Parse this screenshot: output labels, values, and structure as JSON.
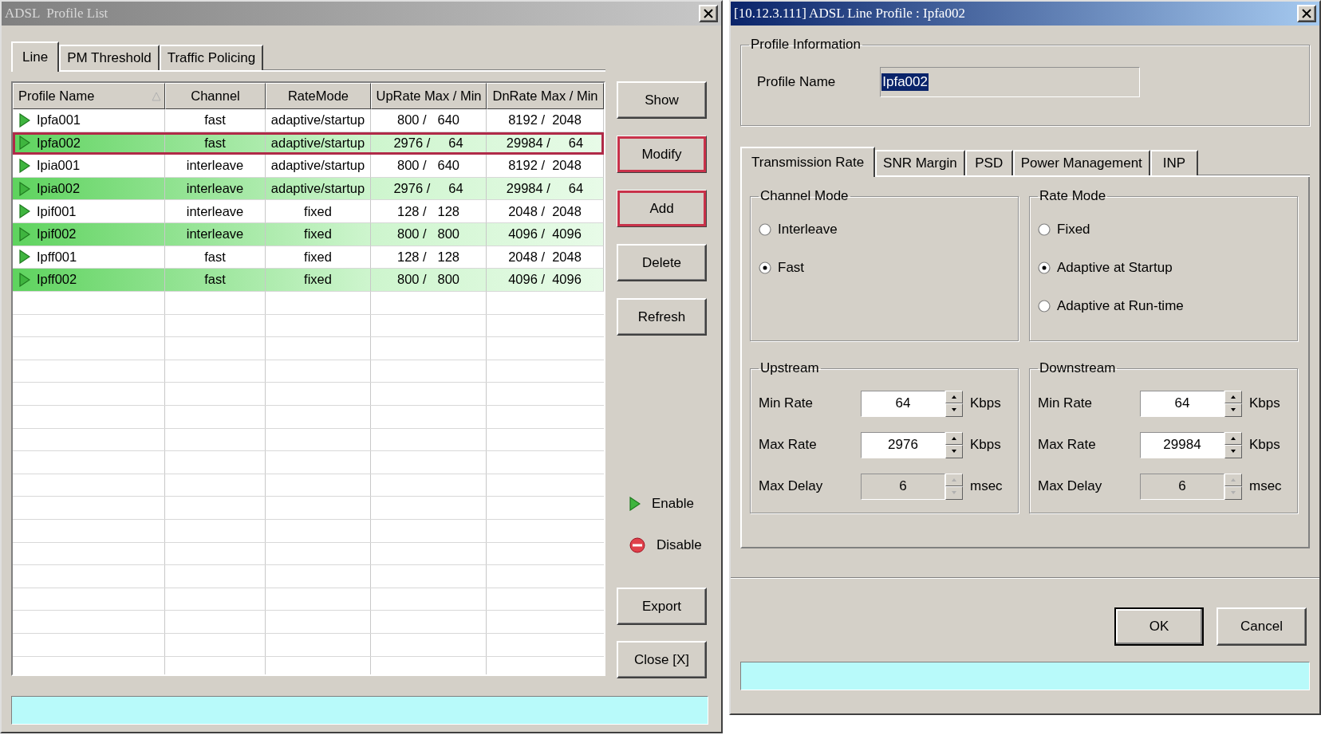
{
  "profile_list": {
    "window": {
      "title": "ADSL  Profile List",
      "active": false
    },
    "tabs": [
      {
        "label": "Line",
        "selected": true
      },
      {
        "label": "PM Threshold",
        "selected": false
      },
      {
        "label": "Traffic Policing",
        "selected": false
      }
    ],
    "table": {
      "columns": [
        {
          "label": "Profile Name",
          "sorted": true
        },
        {
          "label": "Channel",
          "sorted": false
        },
        {
          "label": "RateMode",
          "sorted": false
        },
        {
          "label": "UpRate Max / Min",
          "sorted": false
        },
        {
          "label": "DnRate Max / Min",
          "sorted": false
        }
      ],
      "rows": [
        {
          "enabled": true,
          "selected": false,
          "cells": [
            "Ipfa001",
            "fast",
            "adaptive/startup",
            "800 /   640",
            "8192 /  2048"
          ]
        },
        {
          "enabled": true,
          "selected": true,
          "cells": [
            "Ipfa002",
            "fast",
            "adaptive/startup",
            "2976 /     64",
            "29984 /     64"
          ]
        },
        {
          "enabled": true,
          "selected": false,
          "cells": [
            "Ipia001",
            "interleave",
            "adaptive/startup",
            "800 /   640",
            "8192 /  2048"
          ]
        },
        {
          "enabled": true,
          "selected": false,
          "cells": [
            "Ipia002",
            "interleave",
            "adaptive/startup",
            "2976 /     64",
            "29984 /     64"
          ]
        },
        {
          "enabled": true,
          "selected": false,
          "cells": [
            "Ipif001",
            "interleave",
            "fixed",
            "128 /   128",
            "2048 /  2048"
          ]
        },
        {
          "enabled": true,
          "selected": false,
          "cells": [
            "Ipif002",
            "interleave",
            "fixed",
            "800 /   800",
            "4096 /  4096"
          ]
        },
        {
          "enabled": true,
          "selected": false,
          "cells": [
            "Ipff001",
            "fast",
            "fixed",
            "128 /   128",
            "2048 /  2048"
          ]
        },
        {
          "enabled": true,
          "selected": false,
          "cells": [
            "Ipff002",
            "fast",
            "fixed",
            "800 /   800",
            "4096 /  4096"
          ]
        }
      ]
    },
    "buttons": [
      {
        "label": "Show",
        "highlighted": false
      },
      {
        "label": "Modify",
        "highlighted": true
      },
      {
        "label": "Add",
        "highlighted": true
      },
      {
        "label": "Delete",
        "highlighted": false
      },
      {
        "label": "Refresh",
        "highlighted": false
      }
    ],
    "legend": [
      {
        "kind": "enable",
        "label": "Enable"
      },
      {
        "kind": "disable",
        "label": "Disable"
      }
    ],
    "bottom_buttons": [
      {
        "label": "Export",
        "highlighted": false
      },
      {
        "label": "Close [X]",
        "highlighted": false
      }
    ]
  },
  "line_profile": {
    "window": {
      "title": "[10.12.3.111] ADSL Line Profile : Ipfa002",
      "active": true
    },
    "profile_information": {
      "title": "Profile Information",
      "label": "Profile Name",
      "value": "Ipfa002"
    },
    "tabs": [
      {
        "label": "Transmission Rate",
        "selected": true
      },
      {
        "label": "SNR Margin",
        "selected": false
      },
      {
        "label": "PSD",
        "selected": false
      },
      {
        "label": "Power Management",
        "selected": false
      },
      {
        "label": "INP",
        "selected": false
      }
    ],
    "channel_mode": {
      "title": "Channel Mode",
      "options": [
        {
          "label": "Interleave",
          "selected": false
        },
        {
          "label": "Fast",
          "selected": true
        }
      ]
    },
    "rate_mode": {
      "title": "Rate Mode",
      "options": [
        {
          "label": "Fixed",
          "selected": false
        },
        {
          "label": "Adaptive at Startup",
          "selected": true
        },
        {
          "label": "Adaptive at Run-time",
          "selected": false
        }
      ]
    },
    "upstream": {
      "title": "Upstream",
      "fields": [
        {
          "label": "Min Rate",
          "value": "64",
          "unit": "Kbps",
          "disabled": false
        },
        {
          "label": "Max Rate",
          "value": "2976",
          "unit": "Kbps",
          "disabled": false
        },
        {
          "label": "Max Delay",
          "value": "6",
          "unit": "msec",
          "disabled": true
        }
      ]
    },
    "downstream": {
      "title": "Downstream",
      "fields": [
        {
          "label": "Min Rate",
          "value": "64",
          "unit": "Kbps",
          "disabled": false
        },
        {
          "label": "Max Rate",
          "value": "29984",
          "unit": "Kbps",
          "disabled": false
        },
        {
          "label": "Max Delay",
          "value": "6",
          "unit": "msec",
          "disabled": true
        }
      ]
    },
    "buttons": [
      {
        "label": "OK",
        "default": true
      },
      {
        "label": "Cancel",
        "default": false
      }
    ]
  }
}
